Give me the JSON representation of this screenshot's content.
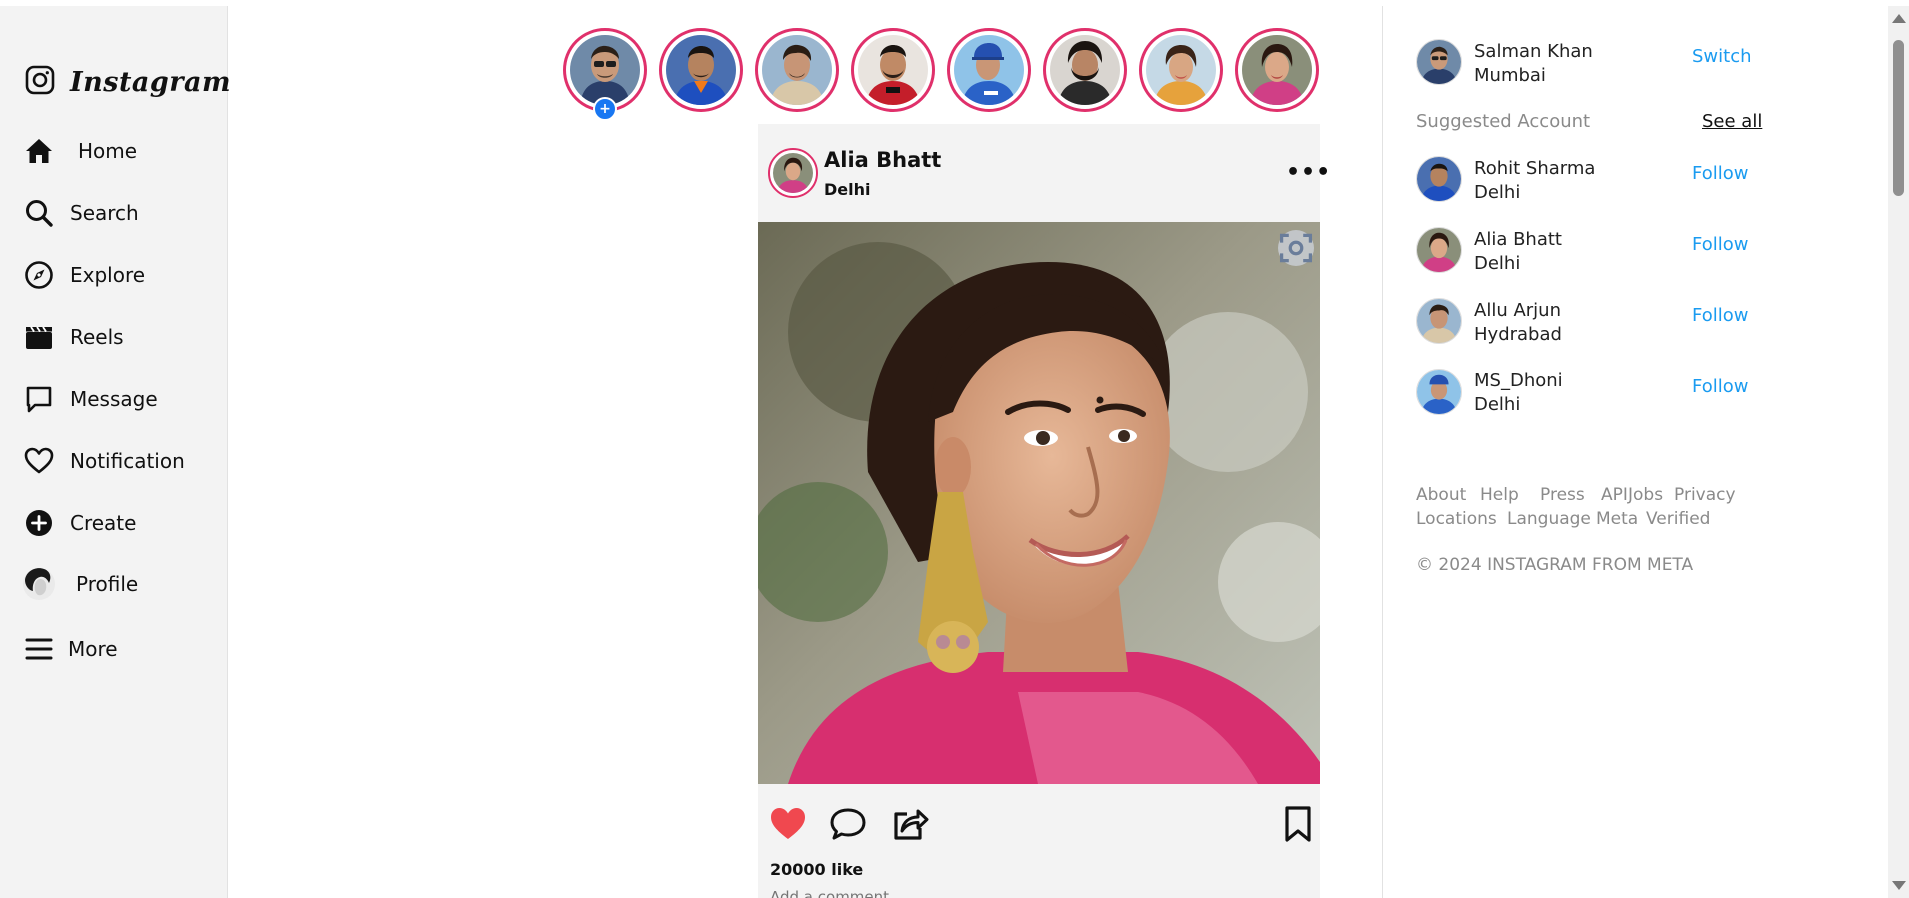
{
  "brand": {
    "name": "Instagram"
  },
  "sidebar": {
    "items": [
      {
        "label": "Home",
        "icon": "home-icon"
      },
      {
        "label": "Search",
        "icon": "search-icon"
      },
      {
        "label": "Explore",
        "icon": "compass-icon"
      },
      {
        "label": "Reels",
        "icon": "clapperboard-icon"
      },
      {
        "label": "Message",
        "icon": "message-icon"
      },
      {
        "label": "Notification",
        "icon": "heart-icon"
      },
      {
        "label": "Create",
        "icon": "plus-circle-icon"
      },
      {
        "label": "Profile",
        "icon": "avatar"
      },
      {
        "label": "More",
        "icon": "hamburger-icon"
      }
    ]
  },
  "stories": {
    "count": 8,
    "own_story_add_badge": "+"
  },
  "post": {
    "author": "Alia Bhatt",
    "location": "Delhi",
    "more_icon": "•••",
    "likes": "20000 like",
    "comment_placeholder": "Add a comment...",
    "liked": true
  },
  "account": {
    "name": "Salman Khan",
    "city": "Mumbai",
    "action": "Switch"
  },
  "suggested": {
    "title": "Suggested Account",
    "see_all": "See all",
    "accounts": [
      {
        "name": "Rohit Sharma",
        "city": "Delhi",
        "action": "Follow"
      },
      {
        "name": "Alia Bhatt",
        "city": "Delhi",
        "action": "Follow"
      },
      {
        "name": "Allu Arjun",
        "city": "Hydrabad",
        "action": "Follow"
      },
      {
        "name": "MS_Dhoni",
        "city": "Delhi",
        "action": "Follow"
      }
    ]
  },
  "footer": {
    "links_row1": [
      "About",
      "Help",
      "Press",
      "API",
      "Jobs",
      "Privacy"
    ],
    "links_row2": [
      "Locations",
      "Language",
      "Meta",
      "Verified"
    ],
    "copyright": "© 2024 INSTAGRAM FROM META"
  },
  "colors": {
    "story_ring": "#e0306b",
    "link_blue": "#1a9bf0",
    "like_red": "#f0484f",
    "badge_blue": "#1877f2"
  }
}
